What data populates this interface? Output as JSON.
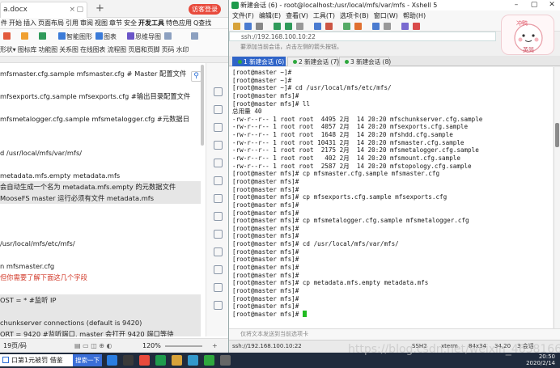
{
  "wps": {
    "tab_title": "a.docx",
    "login_label": "访客登录",
    "menus": [
      "件",
      "开始",
      "插入",
      "页面布局",
      "引用",
      "审阅",
      "视图",
      "章节",
      "安全",
      "开发工具",
      "特色应用",
      "Q查找"
    ],
    "active_menu": "开发工具",
    "ribbon_row1": [
      "智能图形",
      "图表",
      "思维导图",
      "页眉和页脚",
      "页码"
    ],
    "ribbon_row2": [
      "形状",
      "图标库",
      "功能图",
      "关系图",
      "在线图表",
      "流程图",
      "页眉和页脚",
      "页码",
      "水印"
    ],
    "doc_lines": [
      {
        "text": "mfsmaster.cfg.sample mfsmaster.cfg   # Master 配置文件",
        "style": "normal"
      },
      {
        "text": "",
        "style": "normal"
      },
      {
        "text": "mfsexports.cfg.sample mfsexports.cfg #输出目录配置文件",
        "style": "normal"
      },
      {
        "text": "",
        "style": "normal"
      },
      {
        "text": "mfsmetalogger.cfg.sample mfsmetalogger.cfg   #元数据日",
        "style": "normal"
      },
      {
        "text": "",
        "style": "normal"
      },
      {
        "text": "",
        "style": "normal"
      },
      {
        "text": "d /usr/local/mfs/var/mfs/",
        "style": "normal"
      },
      {
        "text": "",
        "style": "normal"
      },
      {
        "text": "metadata.mfs.empty metadata.mfs",
        "style": "normal"
      },
      {
        "text": " 会自动生成一个名为 metadata.mfs.empty 的元数据文件",
        "style": "grey"
      },
      {
        "text": " MooseFS master 运行必须有文件 metadata.mfs",
        "style": "grey"
      },
      {
        "text": "",
        "style": "normal"
      },
      {
        "text": "",
        "style": "normal"
      },
      {
        "text": "",
        "style": "normal"
      },
      {
        "text": "/usr/local/mfs/etc/mfs/",
        "style": "normal"
      },
      {
        "text": "",
        "style": "normal"
      },
      {
        "text": "n mfsmaster.cfg",
        "style": "normal"
      },
      {
        "text": "但你需要了解下面这几个字段",
        "style": "red"
      },
      {
        "text": "",
        "style": "normal"
      },
      {
        "text": "OST = *        #监听 IP",
        "style": "grey"
      },
      {
        "text": "",
        "style": "grey"
      },
      {
        "text": " chunkserver connections (default is 9420)",
        "style": "grey"
      },
      {
        "text": "ORT = 9420   #监听端口, master 会打开 9420 端口等待",
        "style": "grey"
      },
      {
        "text": " 服务器连接",
        "style": "grey"
      }
    ],
    "status_page": "19页/码",
    "zoom": "120%"
  },
  "xshell": {
    "title": "新建会话 (6) - root@localhost:/usr/local/mfs/var/mfs - Xshell 5",
    "menus": [
      "文件(F)",
      "编辑(E)",
      "查看(V)",
      "工具(T)",
      "选项卡(B)",
      "窗口(W)",
      "帮助(H)"
    ],
    "address": "ssh://192.168.100.10:22",
    "hint": "要添加当前会话，点击左侧的箭头按钮。",
    "sticker_text": "英简",
    "tabs": [
      {
        "label": "1 新建会话 (6)",
        "active": true
      },
      {
        "label": "2 新建会话 (7)",
        "active": false
      },
      {
        "label": "3 新建会话 (8)",
        "active": false
      }
    ],
    "terminal_lines": [
      "[root@master ~]#",
      "[root@master ~]#",
      "[root@master ~]# cd /usr/local/mfs/etc/mfs/",
      "[root@master mfs]#",
      "[root@master mfs]# ll",
      "总用量 40",
      "-rw-r--r-- 1 root root  4495 2月  14 20:20 mfschunkserver.cfg.sample",
      "-rw-r--r-- 1 root root  4057 2月  14 20:20 mfsexports.cfg.sample",
      "-rw-r--r-- 1 root root  1648 2月  14 20:20 mfshdd.cfg.sample",
      "-rw-r--r-- 1 root root 10431 2月  14 20:20 mfsmaster.cfg.sample",
      "-rw-r--r-- 1 root root  2175 2月  14 20:20 mfsmetalogger.cfg.sample",
      "-rw-r--r-- 1 root root   402 2月  14 20:20 mfsmount.cfg.sample",
      "-rw-r--r-- 1 root root  2587 2月  14 20:20 mfstopology.cfg.sample",
      "[root@master mfs]# cp mfsmaster.cfg.sample mfsmaster.cfg",
      "[root@master mfs]#",
      "[root@master mfs]#",
      "[root@master mfs]# cp mfsexports.cfg.sample mfsexports.cfg",
      "[root@master mfs]#",
      "[root@master mfs]#",
      "[root@master mfs]# cp mfsmetalogger.cfg.sample mfsmetalogger.cfg",
      "[root@master mfs]#",
      "[root@master mfs]#",
      "[root@master mfs]# cd /usr/local/mfs/var/mfs/",
      "[root@master mfs]#",
      "[root@master mfs]#",
      "[root@master mfs]#",
      "[root@master mfs]#",
      "[root@master mfs]# cp metadata.mfs.empty metadata.mfs",
      "[root@master mfs]#",
      "[root@master mfs]#",
      "[root@master mfs]#",
      "[root@master mfs]# "
    ],
    "input_hint": "仅将文本发送到当前选项卡",
    "status": {
      "address": "ssh://192.168.100.10:22",
      "protocol": "SSH2",
      "term": "xterm",
      "size": "84x34",
      "pos": "34,20",
      "sessions": "3 会话"
    }
  },
  "taskbar": {
    "start_text": "口第1元被罚 借鉴",
    "search_label": "搜索一下",
    "time": "20:50",
    "date": "2020/2/14"
  },
  "watermark": "https://blog.csdn.net/weixin_46381668"
}
